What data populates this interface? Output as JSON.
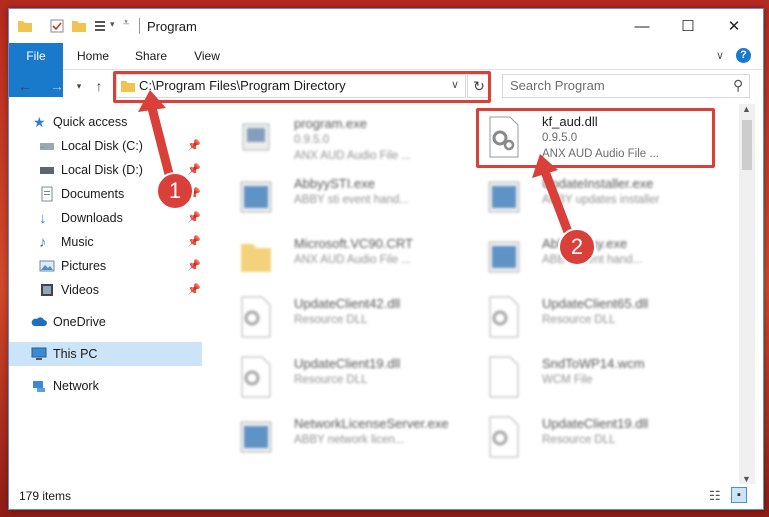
{
  "window": {
    "title": "Program",
    "controls": [
      "—",
      "☐",
      "✕"
    ]
  },
  "ribbon": {
    "tabs": [
      "File",
      "Home",
      "Share",
      "View"
    ]
  },
  "nav": {
    "address": "C:\\Program Files\\Program Directory",
    "search_placeholder": "Search Program"
  },
  "sidebar": {
    "items": [
      {
        "label": "Quick access",
        "icon": "star-icon"
      },
      {
        "label": "Local Disk (C:)",
        "icon": "drive-icon"
      },
      {
        "label": "Local Disk (D:)",
        "icon": "drive-icon"
      },
      {
        "label": "Documents",
        "icon": "documents-icon"
      },
      {
        "label": "Downloads",
        "icon": "download-icon"
      },
      {
        "label": "Music",
        "icon": "music-icon"
      },
      {
        "label": "Pictures",
        "icon": "pictures-icon"
      },
      {
        "label": "Videos",
        "icon": "videos-icon"
      },
      {
        "label": "OneDrive",
        "icon": "cloud-icon"
      },
      {
        "label": "This PC",
        "icon": "computer-icon"
      },
      {
        "label": "Network",
        "icon": "network-icon"
      }
    ]
  },
  "files": [
    {
      "name": "program.exe",
      "line2": "0.9.5.0",
      "line3": "ANX AUD Audio File ..."
    },
    {
      "name": "kf_aud.dll",
      "line2": "0.9.5.0",
      "line3": "ANX AUD Audio File ..."
    },
    {
      "name": "AbbyySTI.exe",
      "line2": "ABBY sti event hand...",
      "line3": ""
    },
    {
      "name": "UpdateInstaller.exe",
      "line2": "ABBY updates installer",
      "line3": ""
    },
    {
      "name": "Microsoft.VC90.CRT",
      "line2": "ANX AUD Audio File ...",
      "line3": ""
    },
    {
      "name": "AbbyyTray.exe",
      "line2": "ABBY event hand...",
      "line3": ""
    },
    {
      "name": "UpdateClient42.dll",
      "line2": "Resource DLL",
      "line3": ""
    },
    {
      "name": "UpdateClient65.dll",
      "line2": "Resource DLL",
      "line3": ""
    },
    {
      "name": "UpdateClient19.dll",
      "line2": "Resource DLL",
      "line3": ""
    },
    {
      "name": "SndToWP14.wcm",
      "line2": "WCM File",
      "line3": ""
    },
    {
      "name": "NetworkLicenseServer.exe",
      "line2": "ABBY network licen...",
      "line3": ""
    },
    {
      "name": "UpdateClient19.dll",
      "line2": "Resource DLL",
      "line3": ""
    }
  ],
  "status": {
    "item_count": "179 items"
  },
  "annotations": {
    "step1": "1",
    "step2": "2",
    "color": "#d9403a"
  }
}
